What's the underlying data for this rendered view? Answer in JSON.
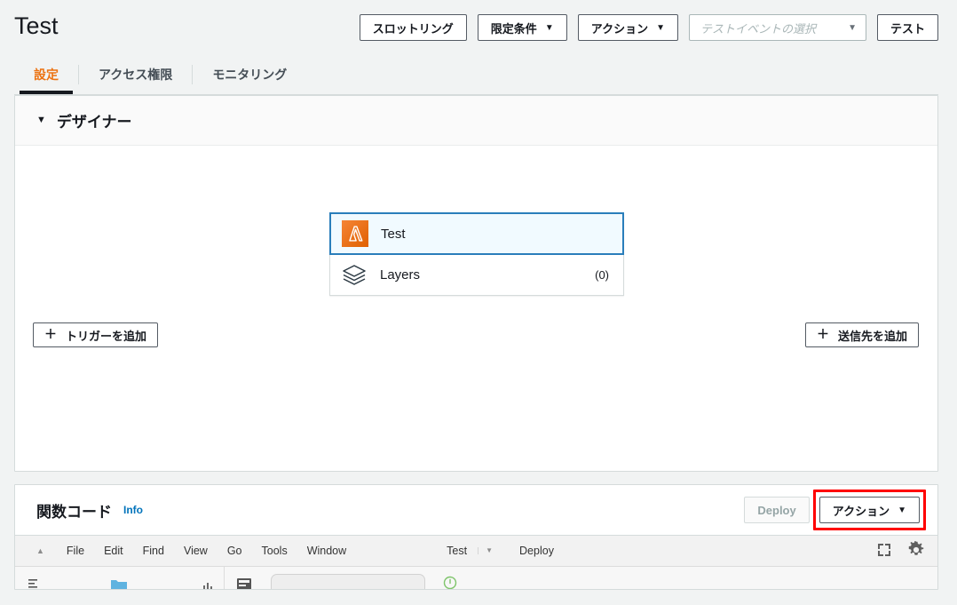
{
  "header": {
    "title": "Test",
    "buttons": [
      {
        "label": "スロットリング",
        "name": "throttle-button",
        "type": "plain"
      },
      {
        "label": "限定条件",
        "name": "qualifiers-button",
        "type": "dropdown"
      },
      {
        "label": "アクション",
        "name": "actions-button",
        "type": "dropdown"
      }
    ],
    "test_event_select": {
      "placeholder": "テストイベントの選択",
      "caret": "▼"
    },
    "test_button": "テスト"
  },
  "tabs": [
    {
      "label": "設定",
      "active": true
    },
    {
      "label": "アクセス権限",
      "active": false
    },
    {
      "label": "モニタリング",
      "active": false
    }
  ],
  "designer": {
    "title": "デザイナー",
    "collapse_caret": "▼",
    "function_node": {
      "label": "Test",
      "icon": "lambda-icon",
      "selected": true
    },
    "layers_row": {
      "label": "Layers",
      "icon": "layers-icon",
      "count": "(0)"
    },
    "add_trigger_button": {
      "label": "トリガーを追加",
      "plus": "＋"
    },
    "add_destination_button": {
      "label": "送信先を追加",
      "plus": "＋"
    }
  },
  "function_code": {
    "title": "関数コード",
    "info_label": "Info",
    "deploy_button": "Deploy",
    "actions_button": {
      "label": "アクション",
      "caret": "▼"
    },
    "highlight_color": "#ff0000"
  },
  "ide": {
    "collapse_caret": "▲",
    "menu_items": [
      "File",
      "Edit",
      "Find",
      "View",
      "Go",
      "Tools",
      "Window"
    ],
    "run_config": "Test",
    "run_caret": "▼",
    "deploy": "Deploy",
    "icons": [
      "fullscreen-icon",
      "gear-icon"
    ]
  },
  "colors": {
    "accent_orange": "#ec7211",
    "link_blue": "#0073bb",
    "selected_blue": "#2a7ebb",
    "lambda_orange": "#ed7100",
    "page_bg": "#f1f3f3"
  }
}
